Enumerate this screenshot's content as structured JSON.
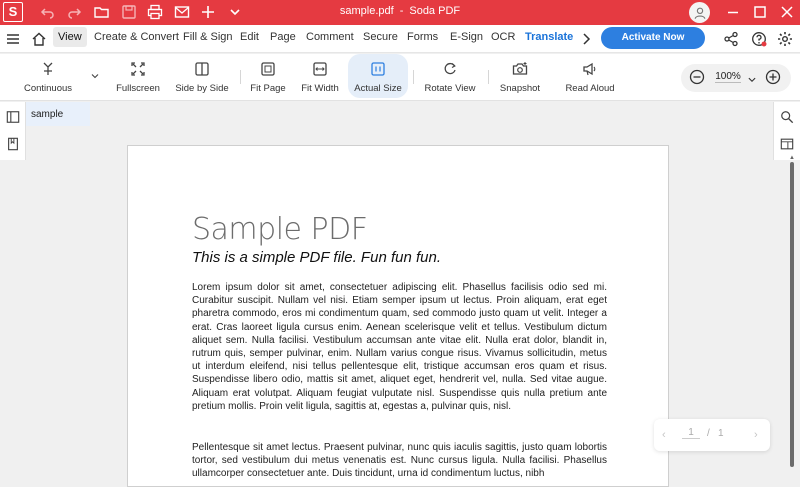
{
  "app": {
    "logo_letter": "S",
    "file_name": "sample.pdf",
    "separator": "-",
    "app_name": "Soda PDF",
    "accent_color": "#e53a41"
  },
  "menu": {
    "items": [
      "View",
      "Create & Convert",
      "Fill & Sign",
      "Edit",
      "Page",
      "Comment",
      "Secure",
      "Forms",
      "E-Sign",
      "OCR",
      "Translate"
    ],
    "active": "View",
    "activate_label": "Activate Now"
  },
  "toolbar": {
    "tools": [
      "Continuous",
      "Fullscreen",
      "Side by Side",
      "Fit Page",
      "Fit Width",
      "Actual Size",
      "Rotate View",
      "Snapshot",
      "Read Aloud"
    ],
    "selected": "Actual Size",
    "zoom_value": "100%"
  },
  "document": {
    "tab_label": "sample",
    "title": "Sample PDF",
    "subtitle": "This is a simple PDF file. Fun fun fun.",
    "paragraph1": "Lorem ipsum dolor sit amet, consectetuer adipiscing elit. Phasellus facilisis odio sed mi. Curabitur suscipit. Nullam vel nisi. Etiam semper ipsum ut lectus. Proin aliquam, erat eget pharetra commodo, eros mi condimentum quam, sed commodo justo quam ut velit. Integer a erat. Cras laoreet ligula cursus enim. Aenean scelerisque velit et tellus. Vestibulum dictum aliquet sem. Nulla facilisi. Vestibulum accumsan ante vitae elit. Nulla erat dolor, blandit in, rutrum quis, semper pulvinar, enim. Nullam varius congue risus. Vivamus sollicitudin, metus ut interdum eleifend, nisi tellus pellentesque elit, tristique accumsan eros quam et risus. Suspendisse libero odio, mattis sit amet, aliquet eget, hendrerit vel, nulla. Sed vitae augue. Aliquam erat volutpat. Aliquam feugiat vulputate nisl. Suspendisse quis nulla pretium ante pretium mollis. Proin velit ligula, sagittis at, egestas a, pulvinar quis, nisl.",
    "paragraph2": "Pellentesque sit amet lectus. Praesent pulvinar, nunc quis iaculis sagittis, justo quam lobortis tortor, sed vestibulum dui metus venenatis est. Nunc cursus ligula. Nulla facilisi. Phasellus ullamcorper consectetuer ante. Duis tincidunt, urna id condimentum luctus, nibh"
  },
  "page_nav": {
    "current": "1",
    "separator": "/",
    "total": "1"
  }
}
